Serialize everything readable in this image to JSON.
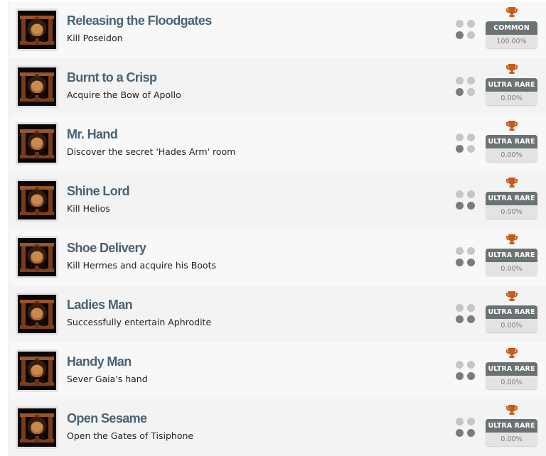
{
  "colors": {
    "title": "#4a6274",
    "trophy": "#c85a1a",
    "badge_bg": "#6a7273",
    "pct_bg": "#e3e4e2",
    "dot_on": "#7b7b7b",
    "dot_off": "#c6c6c6"
  },
  "achievements": [
    {
      "title": "Releasing the Floodgates",
      "description": "Kill Poseidon",
      "icon": "omega-game-icon",
      "difficulty_dots": [
        false,
        false,
        true,
        false
      ],
      "trophy_icon": "trophy-icon",
      "rarity": "COMMON",
      "percent": "100.00%"
    },
    {
      "title": "Burnt to a Crisp",
      "description": "Acquire the Bow of Apollo",
      "icon": "omega-game-icon",
      "difficulty_dots": [
        false,
        false,
        true,
        false
      ],
      "trophy_icon": "trophy-icon",
      "rarity": "ULTRA RARE",
      "percent": "0.00%"
    },
    {
      "title": "Mr. Hand",
      "description": "Discover the secret 'Hades Arm' room",
      "icon": "omega-game-icon",
      "difficulty_dots": [
        false,
        false,
        true,
        false
      ],
      "trophy_icon": "trophy-icon",
      "rarity": "ULTRA RARE",
      "percent": "0.00%"
    },
    {
      "title": "Shine Lord",
      "description": "Kill Helios",
      "icon": "omega-game-icon",
      "difficulty_dots": [
        false,
        false,
        true,
        true
      ],
      "trophy_icon": "trophy-icon",
      "rarity": "ULTRA RARE",
      "percent": "0.00%"
    },
    {
      "title": "Shoe Delivery",
      "description": "Kill Hermes and acquire his Boots",
      "icon": "omega-game-icon",
      "difficulty_dots": [
        false,
        false,
        true,
        true
      ],
      "trophy_icon": "trophy-icon",
      "rarity": "ULTRA RARE",
      "percent": "0.00%"
    },
    {
      "title": "Ladies Man",
      "description": "Successfully entertain Aphrodite",
      "icon": "omega-game-icon",
      "difficulty_dots": [
        false,
        false,
        true,
        true
      ],
      "trophy_icon": "trophy-icon",
      "rarity": "ULTRA RARE",
      "percent": "0.00%"
    },
    {
      "title": "Handy Man",
      "description": "Sever Gaia's hand",
      "icon": "omega-game-icon",
      "difficulty_dots": [
        false,
        false,
        true,
        true
      ],
      "trophy_icon": "trophy-icon",
      "rarity": "ULTRA RARE",
      "percent": "0.00%"
    },
    {
      "title": "Open Sesame",
      "description": "Open the Gates of Tisiphone",
      "icon": "omega-game-icon",
      "difficulty_dots": [
        false,
        false,
        true,
        true
      ],
      "trophy_icon": "trophy-icon",
      "rarity": "ULTRA RARE",
      "percent": "0.00%"
    }
  ]
}
